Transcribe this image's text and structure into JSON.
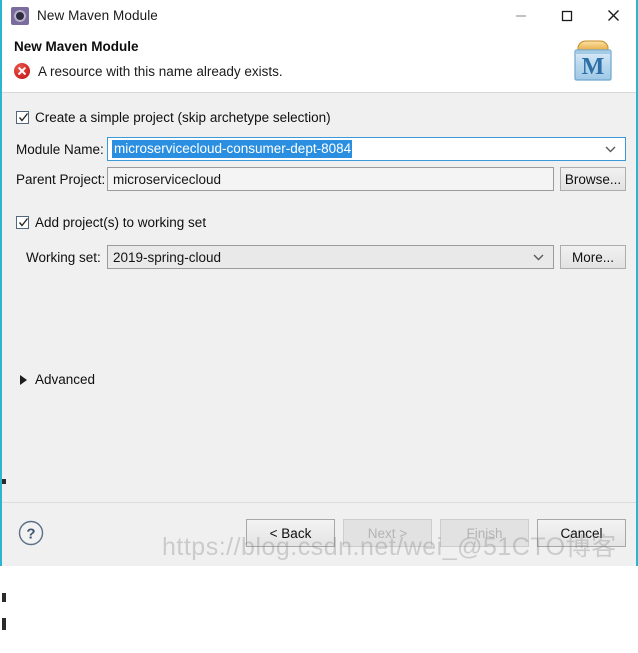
{
  "window": {
    "title": "New Maven Module",
    "app_icon": "maven-module-icon",
    "controls": {
      "minimize": "minimize-icon",
      "maximize": "maximize-icon",
      "close": "close-icon"
    }
  },
  "header": {
    "title": "New Maven Module",
    "message": "A resource with this name already exists.",
    "message_icon": "error-icon",
    "logo": "maven-logo",
    "logo_letter": "M"
  },
  "form": {
    "simple_project": {
      "label": "Create a simple project (skip archetype selection)",
      "checked": true
    },
    "module_name": {
      "label": "Module Name:",
      "value": "microservicecloud-consumer-dept-8084",
      "selected": true
    },
    "parent_project": {
      "label": "Parent Project:",
      "value": "microservicecloud",
      "browse_label": "Browse..."
    },
    "add_to_working_set": {
      "label": "Add project(s) to working set",
      "checked": true
    },
    "working_set": {
      "label": "Working set:",
      "value": "2019-spring-cloud",
      "more_label": "More..."
    },
    "advanced": {
      "label": "Advanced",
      "expanded": false
    }
  },
  "footer": {
    "help_icon": "help-icon",
    "buttons": [
      {
        "label": "< Back",
        "name": "back-button",
        "enabled": true
      },
      {
        "label": "Next >",
        "name": "next-button",
        "enabled": false
      },
      {
        "label": "Finish",
        "name": "finish-button",
        "enabled": false
      },
      {
        "label": "Cancel",
        "name": "cancel-button",
        "enabled": true
      }
    ]
  },
  "watermark": {
    "text": "https://blog.csdn.net/wei_@51CTO博客"
  },
  "colors": {
    "accent_selection": "#2a8fe0",
    "focus_border": "#3a9ad9",
    "error_red": "#cf2222",
    "window_edge": "#2cb5cf",
    "body_bg": "#f0f0f0",
    "header_bg": "#ffffff"
  }
}
